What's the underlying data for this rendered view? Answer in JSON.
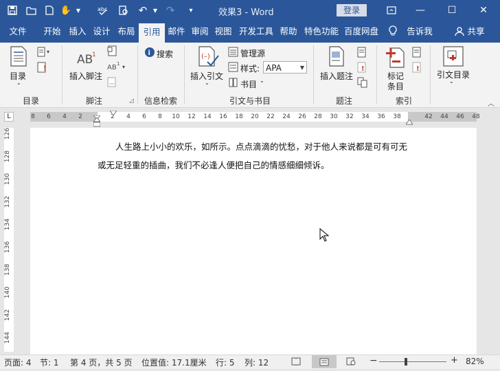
{
  "app": {
    "document_title": "效果3",
    "separator": "-",
    "app_name": "Word",
    "login_label": "登录"
  },
  "tabs": [
    "文件",
    "开始",
    "插入",
    "设计",
    "布局",
    "引用",
    "邮件",
    "审阅",
    "视图",
    "开发工具",
    "帮助",
    "特色功能",
    "百度网盘"
  ],
  "active_tab": "引用",
  "tell_me": "告诉我",
  "share": "共享",
  "ribbon": {
    "toc": {
      "button": "目录",
      "group": "目录"
    },
    "footnotes": {
      "insert": "插入脚注",
      "group": "脚注"
    },
    "research": {
      "search": "搜索",
      "group": "信息检索"
    },
    "citations": {
      "insert_citation": "插入引文",
      "manage_sources": "管理源",
      "style_label": "样式:",
      "style_value": "APA",
      "bibliography": "书目",
      "group": "引文与书目"
    },
    "captions": {
      "insert_caption": "插入题注",
      "group": "题注"
    },
    "index": {
      "mark_entry": "标记\n条目",
      "mark_line1": "标记",
      "mark_line2": "条目",
      "group": "索引"
    },
    "authorities": {
      "mark_citation": "引文目录"
    }
  },
  "ruler": {
    "ticks": [
      "8",
      "6",
      "4",
      "2",
      "2",
      "4",
      "6",
      "8",
      "10",
      "12",
      "14",
      "16",
      "18",
      "20",
      "22",
      "24",
      "26",
      "28",
      "30",
      "32",
      "34",
      "36",
      "38",
      "42",
      "44",
      "46",
      "48"
    ],
    "vticks": [
      "126",
      "128",
      "130",
      "132",
      "134",
      "136",
      "138",
      "140",
      "142",
      "144"
    ]
  },
  "document": {
    "paragraph": "人生路上小小的欢乐，如所示。点点滴滴的忧愁，对于他人来说都是可有可无或无足轻重的插曲，我们不必逢人便把自己的情感细细倾诉。"
  },
  "status": {
    "page": "页面: 4",
    "section": "节: 1",
    "page_of": "第 4 页，共 5 页",
    "position": "位置值: 17.1厘米",
    "line": "行: 5",
    "column": "列: 12",
    "zoom": "82%",
    "zoom_level": 0.82
  },
  "colors": {
    "accent": "#2b579a",
    "ribbon_bg": "#f3f3f3"
  }
}
